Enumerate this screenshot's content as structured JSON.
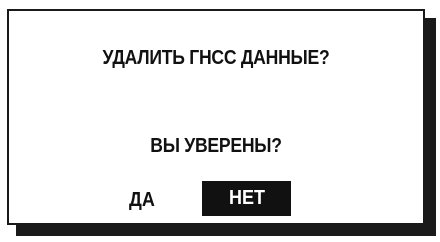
{
  "dialog": {
    "title": "УДАЛИТЬ ГНСС ДАННЫЕ?",
    "question": "ВЫ УВЕРЕНЫ?",
    "options": {
      "yes_label": "ДА",
      "no_label": "НЕТ",
      "selected": "НЕТ"
    }
  },
  "colors": {
    "background": "#ffffff",
    "border": "#1a1a1a",
    "shadow": "#1a1a1a",
    "selected_bg": "#111111",
    "selected_text": "#ffffff",
    "text": "#111111"
  }
}
